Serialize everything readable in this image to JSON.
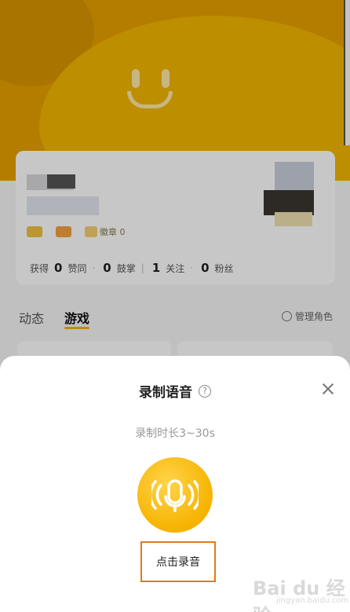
{
  "background": {
    "badges": [
      "",
      "",
      "",
      "徽章 0"
    ],
    "stats": [
      {
        "prefix": "获得",
        "value": "0",
        "label": "赞同"
      },
      {
        "value": "0",
        "label": "鼓掌"
      },
      {
        "value": "1",
        "label": "关注"
      },
      {
        "value": "0",
        "label": "粉丝"
      }
    ],
    "tabs": [
      "动态",
      "游戏"
    ],
    "manage_label": "管理角色"
  },
  "sheet": {
    "title": "录制语音",
    "help_glyph": "?",
    "duration_hint": "录制时长3~30s",
    "record_label": "点击录音"
  },
  "watermark": {
    "logo": "Bai du 经验",
    "sub": "jingyan.baidu.com"
  },
  "colors": {
    "accent": "#f6b300",
    "highlight_box": "#e07b1c"
  }
}
